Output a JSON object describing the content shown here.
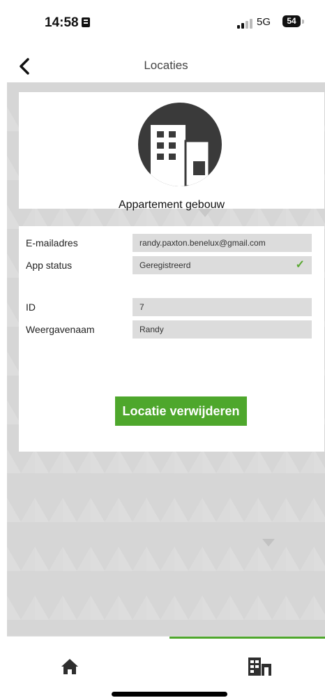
{
  "status_bar": {
    "time": "14:58",
    "network": "5G",
    "battery": "54"
  },
  "header": {
    "title": "Locaties",
    "back_icon": "chevron-left-icon"
  },
  "location": {
    "name": "Appartement gebouw",
    "icon": "building-icon"
  },
  "details": {
    "email_label": "E-mailadres",
    "email_value": "randy.paxton.benelux@gmail.com",
    "status_label": "App status",
    "status_value": "Geregistreerd",
    "status_icon": "checkmark-icon",
    "id_label": "ID",
    "id_value": "7",
    "display_name_label": "Weergavenaam",
    "display_name_value": "Randy"
  },
  "actions": {
    "delete_label": "Locatie verwijderen"
  },
  "tab_bar": {
    "items": [
      {
        "icon": "home-icon",
        "active": false
      },
      {
        "icon": "buildings-icon",
        "active": true
      }
    ]
  },
  "colors": {
    "accent": "#4ea72c",
    "background": "#d6d6d6",
    "avatar": "#3a3a3a"
  }
}
